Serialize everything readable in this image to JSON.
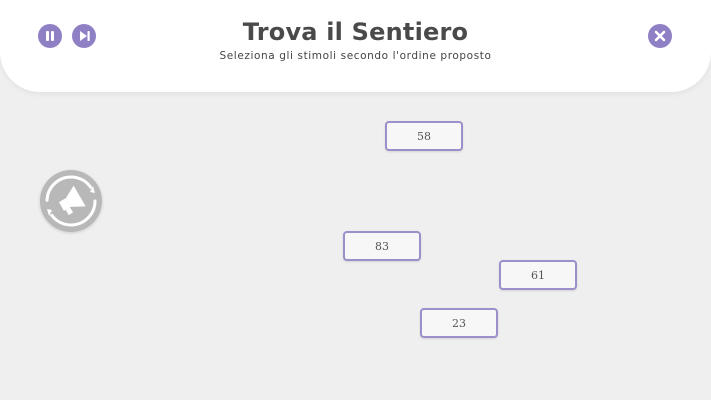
{
  "header": {
    "title": "Trova il Sentiero",
    "subtitle": "Seleziona gli stimoli secondo l'ordine proposto",
    "buttons": {
      "pause_icon": "pause-icon",
      "next_icon": "skip-next-icon",
      "close_icon": "close-icon"
    }
  },
  "controls": {
    "sound_icon": "megaphone-replay-icon"
  },
  "stimuli": [
    {
      "label": "58"
    },
    {
      "label": "83"
    },
    {
      "label": "61"
    },
    {
      "label": "23"
    }
  ],
  "colors": {
    "accent": "#8f7fc4",
    "background": "#efefef",
    "header": "#ffffff",
    "stimulus_border": "#9c8fcb"
  }
}
